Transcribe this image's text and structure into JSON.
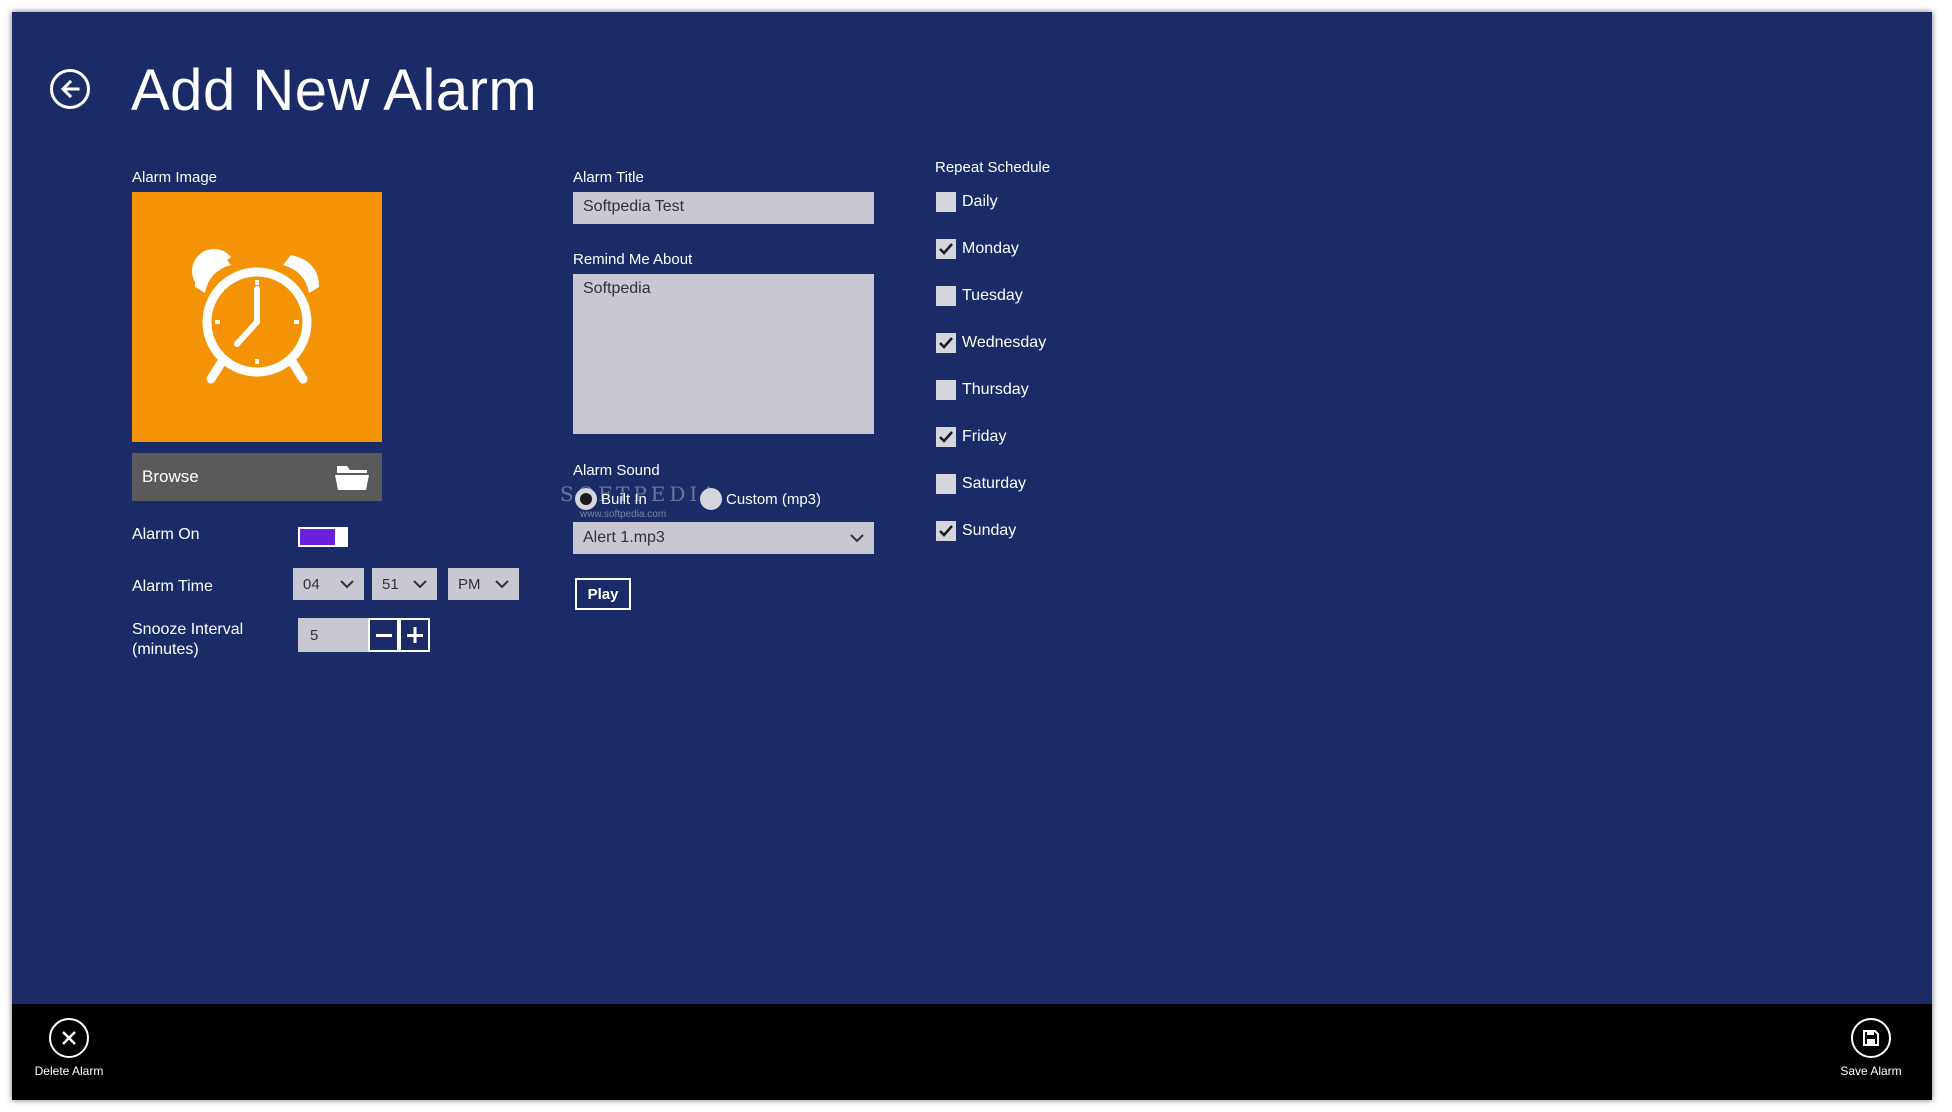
{
  "page": {
    "title": "Add New Alarm"
  },
  "image_section": {
    "label": "Alarm Image",
    "browse_label": "Browse"
  },
  "alarm_on": {
    "label": "Alarm On",
    "checked": true
  },
  "alarm_time": {
    "label": "Alarm Time",
    "hour": "04",
    "minute": "51",
    "ampm": "PM"
  },
  "snooze": {
    "label_line1": "Snooze Interval",
    "label_line2": "(minutes)",
    "value": "5"
  },
  "alarm_title": {
    "label": "Alarm Title",
    "value": "Softpedia Test"
  },
  "remind": {
    "label": "Remind Me About",
    "value": "Softpedia"
  },
  "sound": {
    "label": "Alarm Sound",
    "option_builtin": "Built In",
    "option_custom": "Custom (mp3)",
    "selected_file": "Alert 1.mp3",
    "play_label": "Play"
  },
  "watermark": {
    "text": "SOFTPEDIA",
    "sub": "www.softpedia.com"
  },
  "repeat": {
    "label": "Repeat Schedule",
    "days": [
      {
        "label": "Daily",
        "checked": false
      },
      {
        "label": "Monday",
        "checked": true
      },
      {
        "label": "Tuesday",
        "checked": false
      },
      {
        "label": "Wednesday",
        "checked": true
      },
      {
        "label": "Thursday",
        "checked": false
      },
      {
        "label": "Friday",
        "checked": true
      },
      {
        "label": "Saturday",
        "checked": false
      },
      {
        "label": "Sunday",
        "checked": true
      }
    ]
  },
  "appbar": {
    "delete_label": "Delete Alarm",
    "save_label": "Save Alarm"
  },
  "colors": {
    "background": "#1b2b67",
    "tile": "#f59306",
    "toggle_fill": "#6b1edc",
    "appbar": "#000000"
  },
  "icons": {
    "back": "back-arrow-icon",
    "tile": "alarm-clock-icon",
    "browse": "folder-icon",
    "delete": "close-icon",
    "save": "save-disk-icon"
  }
}
